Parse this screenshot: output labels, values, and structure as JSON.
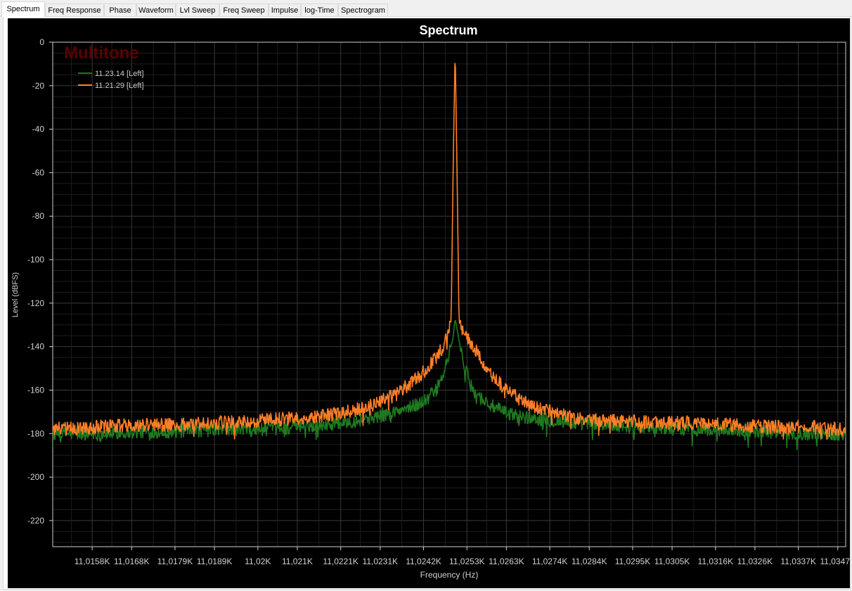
{
  "tabs": [
    {
      "label": "Spectrum",
      "active": true
    },
    {
      "label": "Freq Response",
      "active": false
    },
    {
      "label": "Phase",
      "active": false
    },
    {
      "label": "Waveform",
      "active": false
    },
    {
      "label": "Lvl Sweep",
      "active": false
    },
    {
      "label": "Freq Sweep",
      "active": false
    },
    {
      "label": "Impulse",
      "active": false
    },
    {
      "label": "log-Time",
      "active": false
    },
    {
      "label": "Spectrogram",
      "active": false
    }
  ],
  "chart_data": {
    "type": "line",
    "title": "Spectrum",
    "watermark": "Multitone",
    "xlabel": "Frequency (Hz)",
    "ylabel": "Level (dBFS)",
    "xlim": [
      11014.8,
      11034.9
    ],
    "ylim": [
      -232,
      0
    ],
    "y_ticks": [
      0,
      -20,
      -40,
      -60,
      -80,
      -100,
      -120,
      -140,
      -160,
      -180,
      -200,
      -220
    ],
    "x_ticks": [
      {
        "value": 11015.8,
        "label": "11,0158K"
      },
      {
        "value": 11016.8,
        "label": "11,0168K"
      },
      {
        "value": 11017.9,
        "label": "11,0179K"
      },
      {
        "value": 11018.9,
        "label": "11,0189K"
      },
      {
        "value": 11020.0,
        "label": "11,02K"
      },
      {
        "value": 11021.0,
        "label": "11,021K"
      },
      {
        "value": 11022.1,
        "label": "11,0221K"
      },
      {
        "value": 11023.1,
        "label": "11,0231K"
      },
      {
        "value": 11024.2,
        "label": "11,0242K"
      },
      {
        "value": 11025.3,
        "label": "11,0253K"
      },
      {
        "value": 11026.3,
        "label": "11,0263K"
      },
      {
        "value": 11027.4,
        "label": "11,0274K"
      },
      {
        "value": 11028.4,
        "label": "11,0284K"
      },
      {
        "value": 11029.5,
        "label": "11,0295K"
      },
      {
        "value": 11030.5,
        "label": "11,0305K"
      },
      {
        "value": 11031.6,
        "label": "11,0316K"
      },
      {
        "value": 11032.6,
        "label": "11,0326K"
      },
      {
        "value": 11033.7,
        "label": "11,0337K"
      },
      {
        "value": 11034.7,
        "label": "11,0347K"
      }
    ],
    "grid": true,
    "legend_position": "top-left",
    "series": [
      {
        "name": "11.23.14 [Left]",
        "color": "#1f7a1f",
        "x": [
          11014.8,
          11016.0,
          11017.0,
          11018.0,
          11019.0,
          11020.0,
          11021.0,
          11021.5,
          11022.0,
          11022.5,
          11023.0,
          11023.5,
          11024.0,
          11024.3,
          11024.6,
          11024.8,
          11024.95,
          11025.0,
          11025.1,
          11025.25,
          11025.4,
          11025.6,
          11025.9,
          11026.2,
          11026.6,
          11027.0,
          11027.5,
          11028.0,
          11029.0,
          11030.0,
          11031.0,
          11032.0,
          11033.0,
          11034.0,
          11034.9
        ],
        "values": [
          -180,
          -180,
          -179,
          -179,
          -178,
          -178,
          -177,
          -176,
          -175,
          -174,
          -172,
          -170,
          -167,
          -164,
          -158,
          -147,
          -136,
          -127,
          -137,
          -150,
          -158,
          -163,
          -167,
          -170,
          -172,
          -173,
          -174,
          -175,
          -176,
          -177,
          -178,
          -178,
          -179,
          -180,
          -180
        ]
      },
      {
        "name": "11.21.29 [Left]",
        "color": "#ff7f27",
        "x": [
          11014.8,
          11016.0,
          11017.0,
          11018.0,
          11019.0,
          11020.0,
          11021.0,
          11021.5,
          11022.0,
          11022.5,
          11023.0,
          11023.5,
          11024.0,
          11024.3,
          11024.6,
          11024.8,
          11024.9,
          11024.95,
          11025.0,
          11025.05,
          11025.1,
          11025.2,
          11025.3,
          11025.5,
          11025.7,
          11026.0,
          11026.4,
          11026.8,
          11027.2,
          11027.6,
          11028.0,
          11029.0,
          11030.0,
          11031.0,
          11032.0,
          11033.0,
          11034.0,
          11034.9
        ],
        "values": [
          -178,
          -177,
          -176,
          -176,
          -175,
          -174,
          -173,
          -172,
          -171,
          -169,
          -166,
          -162,
          -155,
          -150,
          -143,
          -136,
          -128,
          -60,
          -2,
          -62,
          -129,
          -133,
          -136,
          -141,
          -148,
          -155,
          -161,
          -166,
          -169,
          -171,
          -173,
          -174,
          -175,
          -175,
          -176,
          -177,
          -177,
          -178
        ]
      }
    ]
  }
}
